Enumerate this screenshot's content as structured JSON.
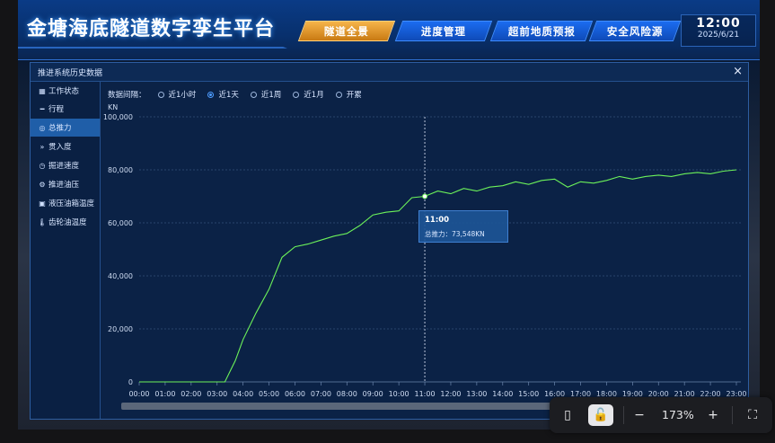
{
  "app": {
    "title": "金塘海底隧道数字孪生平台"
  },
  "nav": [
    "隧道全景",
    "进度管理",
    "超前地质预报",
    "安全风险源"
  ],
  "nav_active": 0,
  "clock": {
    "time": "12:00",
    "date": "2025/6/21"
  },
  "modal": {
    "title": "推进系统历史数据",
    "close_label": "×",
    "sidebar": [
      {
        "label": "工作状态",
        "icon": "grid-icon"
      },
      {
        "label": "行程",
        "icon": "ruler-icon"
      },
      {
        "label": "总推力",
        "icon": "target-icon",
        "active": true
      },
      {
        "label": "贯入度",
        "icon": "chevrons-icon"
      },
      {
        "label": "掘进速度",
        "icon": "speed-icon"
      },
      {
        "label": "推进油压",
        "icon": "oil-icon"
      },
      {
        "label": "液压油箱温度",
        "icon": "tank-icon"
      },
      {
        "label": "齿轮油温度",
        "icon": "thermometer-icon"
      }
    ],
    "filter": {
      "label": "数据间隔：",
      "options": [
        "近1小时",
        "近1天",
        "近1周",
        "近1月",
        "开累"
      ],
      "selected": 1
    }
  },
  "tooltip": {
    "time": "11:00",
    "series": "总推力：73,548KN"
  },
  "chart_data": {
    "type": "line",
    "ylabel": "KN",
    "ylim": [
      0,
      100000
    ],
    "yticks": [
      "100,000",
      "80,000",
      "60,000",
      "40,000",
      "20,000",
      "0"
    ],
    "xticks": [
      "00:00",
      "01:00",
      "02:00",
      "03:00",
      "04:00",
      "05:00",
      "06:00",
      "07:00",
      "08:00",
      "09:00",
      "10:00",
      "11:00",
      "12:00",
      "13:00",
      "14:00",
      "15:00",
      "16:00",
      "17:00",
      "18:00",
      "19:00",
      "20:00",
      "21:00",
      "22:00",
      "23:00"
    ],
    "x_hours": [
      0,
      0.5,
      1,
      1.5,
      2,
      2.5,
      3,
      3.3,
      3.7,
      4,
      4.5,
      5,
      5.5,
      6,
      6.5,
      7,
      7.5,
      8,
      8.5,
      9,
      9.5,
      10,
      10.5,
      11,
      11.5,
      12,
      12.5,
      13,
      13.5,
      14,
      14.5,
      15,
      15.5,
      16,
      16.5,
      17,
      17.5,
      18,
      18.5,
      19,
      19.5,
      20,
      20.5,
      21,
      21.5,
      22,
      22.5,
      23
    ],
    "values": [
      0,
      0,
      0,
      0,
      0,
      0,
      0,
      0,
      8000,
      16000,
      26000,
      35000,
      47000,
      51000,
      52000,
      53500,
      55000,
      56000,
      59000,
      63000,
      64000,
      64500,
      69500,
      70000,
      72000,
      71000,
      73000,
      72000,
      73500,
      74000,
      75500,
      74500,
      76000,
      76500,
      73500,
      75500,
      75000,
      76000,
      77500,
      76500,
      77500,
      78000,
      77500,
      78500,
      79000,
      78500,
      79500,
      80000
    ],
    "highlight_hour": 11,
    "grid": true,
    "line_color": "#6cf25a"
  },
  "toolbar": {
    "zoom": "173%"
  }
}
